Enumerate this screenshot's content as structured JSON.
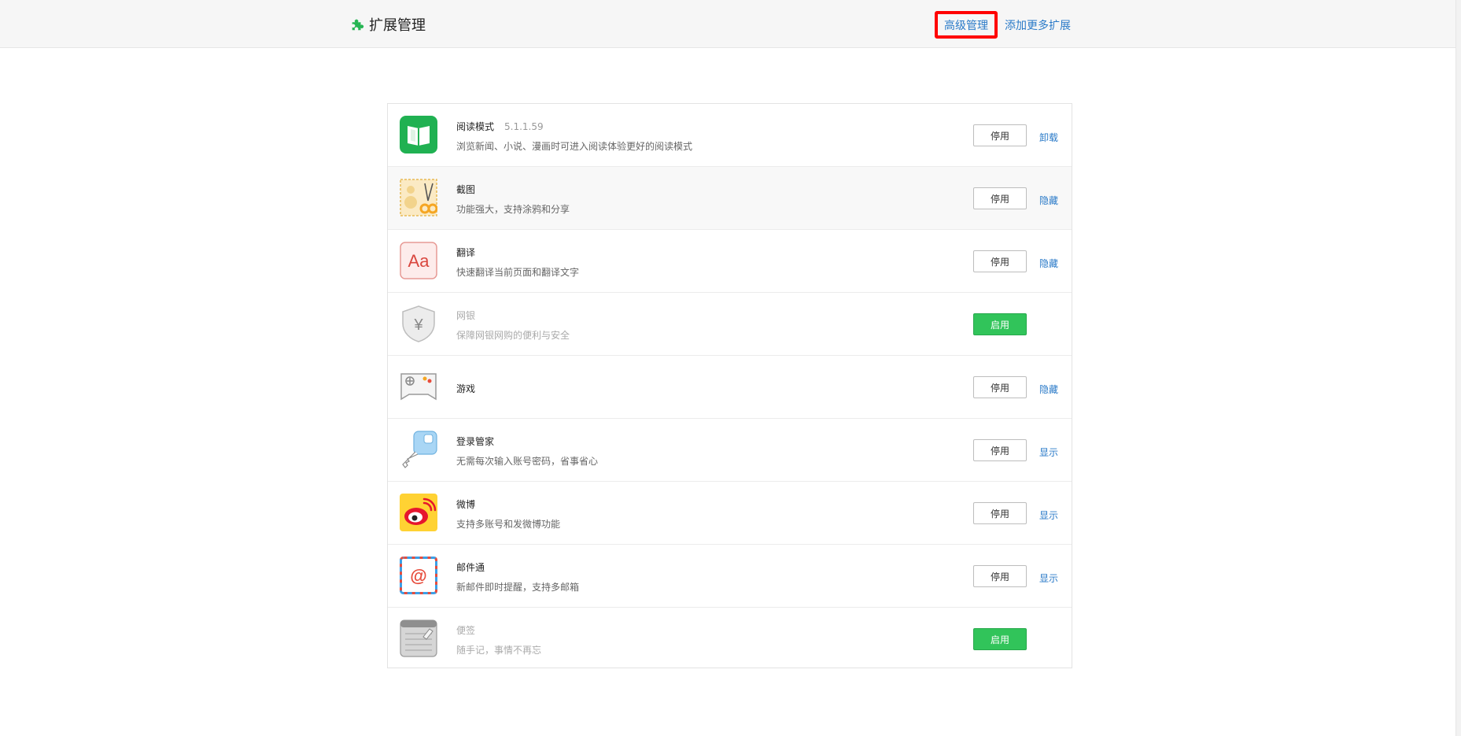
{
  "header": {
    "title": "扩展管理",
    "advanced_label": "高级管理",
    "more_label": "添加更多扩展"
  },
  "extensions": [
    {
      "name": "阅读模式",
      "version": "5.1.1.59",
      "desc": "浏览新闻、小说、漫画时可进入阅读体验更好的阅读模式",
      "button": "停用",
      "link": "卸载"
    },
    {
      "name": "截图",
      "desc": "功能强大，支持涂鸦和分享",
      "button": "停用",
      "link": "隐藏"
    },
    {
      "name": "翻译",
      "desc": "快速翻译当前页面和翻译文字",
      "button": "停用",
      "link": "隐藏"
    },
    {
      "name": "网银",
      "desc": "保障网银网购的便利与安全",
      "button": "启用"
    },
    {
      "name": "游戏",
      "button": "停用",
      "link": "隐藏"
    },
    {
      "name": "登录管家",
      "desc": "无需每次输入账号密码，省事省心",
      "button": "停用",
      "link": "显示"
    },
    {
      "name": "微博",
      "desc": "支持多账号和发微博功能",
      "button": "停用",
      "link": "显示"
    },
    {
      "name": "邮件通",
      "desc": "新邮件即时提醒，支持多邮箱",
      "button": "停用",
      "link": "显示"
    },
    {
      "name": "便签",
      "desc": "随手记，事情不再忘",
      "button": "启用"
    }
  ],
  "icons": {
    "translate_glyph": "Aa",
    "bank_glyph": "¥",
    "mail_glyph": "@"
  },
  "colors": {
    "accent": "#2a7ac8",
    "enable_green": "#31c45a",
    "highlight": "#ff0000"
  }
}
